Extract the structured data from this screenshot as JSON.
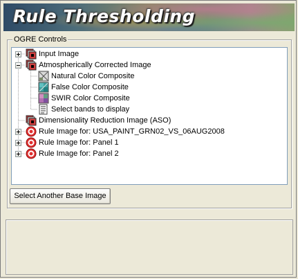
{
  "banner": {
    "title": "Rule Thresholding"
  },
  "group": {
    "label": "OGRE Controls"
  },
  "tree": {
    "items": [
      {
        "label": "Input Image",
        "icon": "raster-stack-icon",
        "expander": "plus"
      },
      {
        "label": "Atmospherically Corrected Image",
        "icon": "raster-stack-icon",
        "expander": "minus"
      },
      {
        "label": "Natural Color Composite",
        "icon": "natural-color-composite-icon"
      },
      {
        "label": "False Color Composite",
        "icon": "false-color-composite-icon"
      },
      {
        "label": "SWIR Color Composite",
        "icon": "swir-composite-icon"
      },
      {
        "label": "Select bands to display",
        "icon": "band-list-icon"
      },
      {
        "label": "Dimensionality Reduction Image (ASO)",
        "icon": "raster-stack-icon"
      },
      {
        "label": "Rule Image for: USA_PAINT_GRN02_VS_06AUG2008",
        "icon": "target-icon",
        "expander": "plus"
      },
      {
        "label": "Rule Image for: Panel 1",
        "icon": "target-icon",
        "expander": "plus"
      },
      {
        "label": "Rule Image for: Panel 2",
        "icon": "target-icon",
        "expander": "plus"
      }
    ]
  },
  "actions": {
    "select_base_label": "Select Another Base Image"
  }
}
